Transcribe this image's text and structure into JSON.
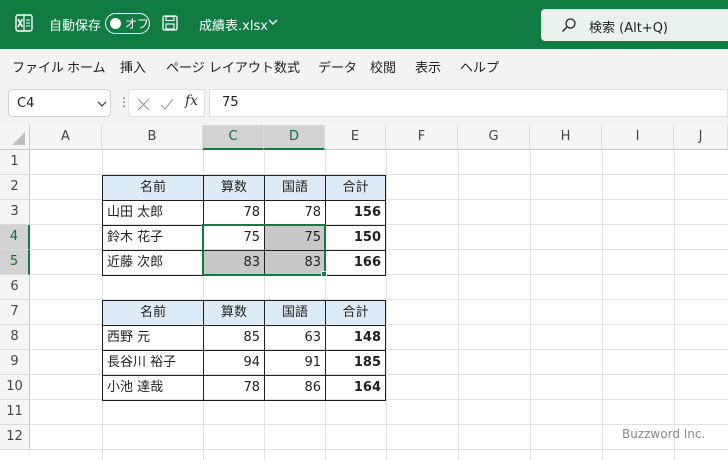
{
  "titlebar": {
    "autosave_label": "自動保存",
    "autosave_state": "オフ",
    "filename": "成績表.xlsx",
    "search_placeholder": "検索 (Alt+Q)",
    "accent": "#107c41"
  },
  "menu": [
    "ファイル",
    "ホーム",
    "挿入",
    "ページ レイアウト",
    "数式",
    "データ",
    "校閲",
    "表示",
    "ヘルプ"
  ],
  "formula_bar": {
    "name_box": "C4",
    "fx": "fx",
    "value": "75"
  },
  "columns": [
    "A",
    "B",
    "C",
    "D",
    "E",
    "F",
    "G",
    "H",
    "I",
    "J"
  ],
  "rows": [
    "1",
    "2",
    "3",
    "4",
    "5",
    "6",
    "7",
    "8",
    "9",
    "10",
    "11",
    "12"
  ],
  "table1": {
    "headers": [
      "名前",
      "算数",
      "国語",
      "合計"
    ],
    "rows": [
      [
        "山田 太郎",
        "78",
        "78",
        "156"
      ],
      [
        "鈴木 花子",
        "75",
        "75",
        "150"
      ],
      [
        "近藤 次郎",
        "83",
        "83",
        "166"
      ]
    ]
  },
  "table2": {
    "headers": [
      "名前",
      "算数",
      "国語",
      "合計"
    ],
    "rows": [
      [
        "西野 元",
        "85",
        "63",
        "148"
      ],
      [
        "長谷川 裕子",
        "94",
        "91",
        "185"
      ],
      [
        "小池 達哉",
        "78",
        "86",
        "164"
      ]
    ]
  },
  "watermark": "Buzzword Inc."
}
